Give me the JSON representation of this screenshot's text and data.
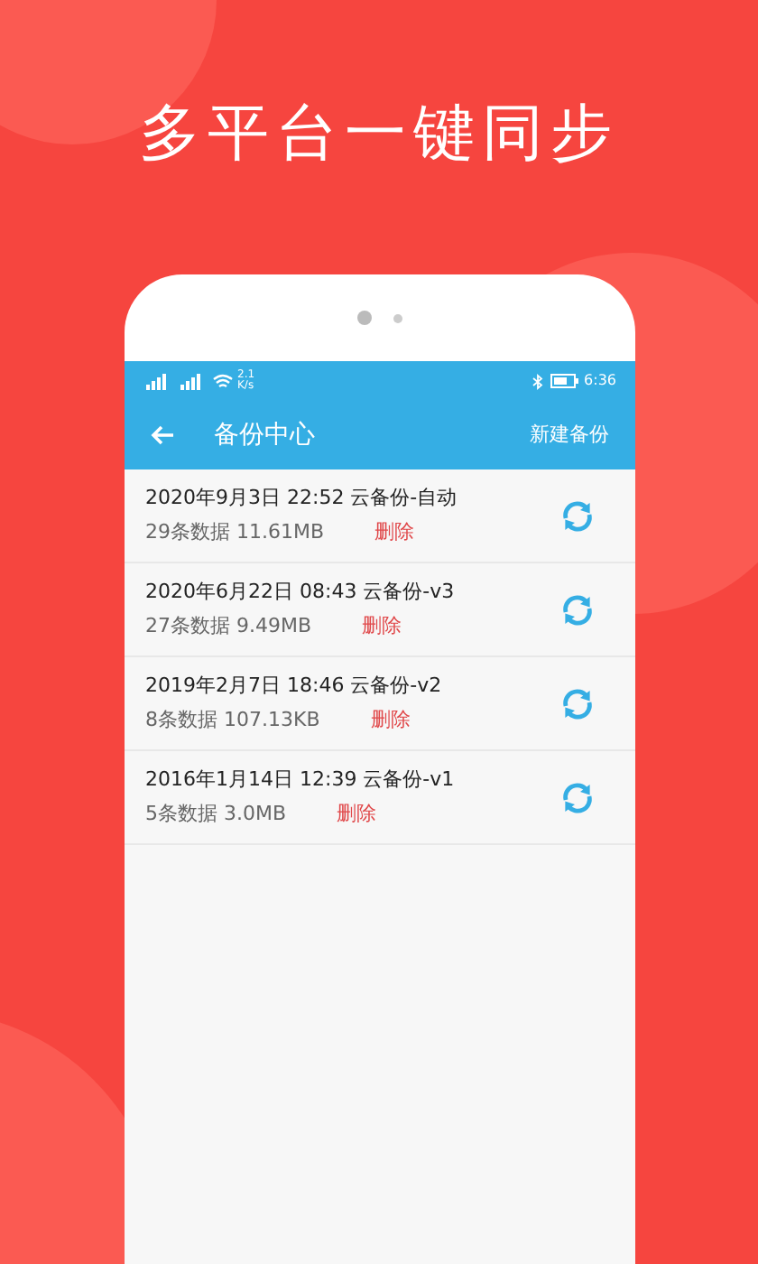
{
  "headline": "多平台一键同步",
  "status_bar": {
    "speed": "2.1\nK/s",
    "time": "6:36"
  },
  "app_bar": {
    "title": "备份中心",
    "action": "新建备份"
  },
  "backups": [
    {
      "title": "2020年9月3日 22:52 云备份-自动",
      "meta": "29条数据 11.61MB",
      "delete": "删除"
    },
    {
      "title": "2020年6月22日 08:43 云备份-v3",
      "meta": "27条数据 9.49MB",
      "delete": "删除"
    },
    {
      "title": "2019年2月7日 18:46 云备份-v2",
      "meta": "8条数据 107.13KB",
      "delete": "删除"
    },
    {
      "title": "2016年1月14日 12:39 云备份-v1",
      "meta": "5条数据 3.0MB",
      "delete": "删除"
    }
  ]
}
